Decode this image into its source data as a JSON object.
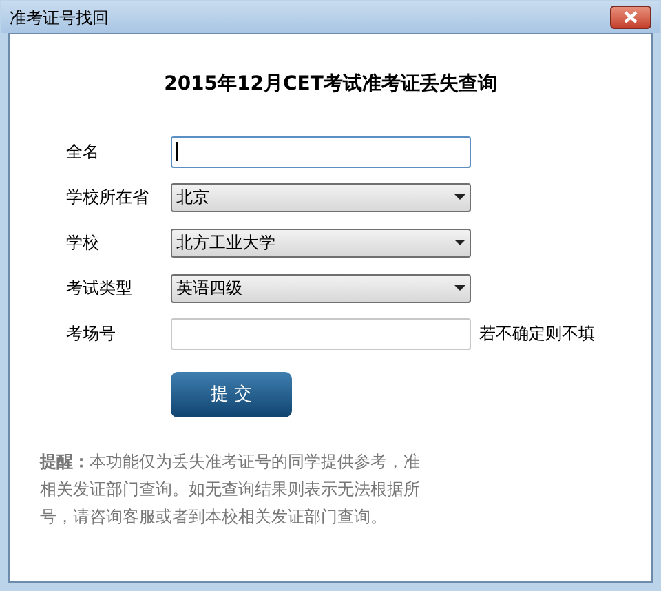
{
  "window": {
    "title": "准考证号找回"
  },
  "heading": "2015年12月CET考试准考证丢失查询",
  "fields": [
    {
      "label": "全名",
      "kind": "text",
      "focused": true
    },
    {
      "label": "学校所在省",
      "kind": "select",
      "value": "北京"
    },
    {
      "label": "学校",
      "kind": "select",
      "value": "北方工业大学"
    },
    {
      "label": "考试类型",
      "kind": "select",
      "value": "英语四级"
    },
    {
      "label": "考场号",
      "kind": "text",
      "focused": false,
      "hint": "若不确定则不填"
    }
  ],
  "submit_button": "提 交",
  "notice_lines": [
    "**提醒：**本功能仅为丢失准考证号的同学提供参考，准",
    "相关发证部门查询。如无查询结果则表示无法根据所",
    "号，请咨询客服或者到本校相关发证部门查询。"
  ]
}
